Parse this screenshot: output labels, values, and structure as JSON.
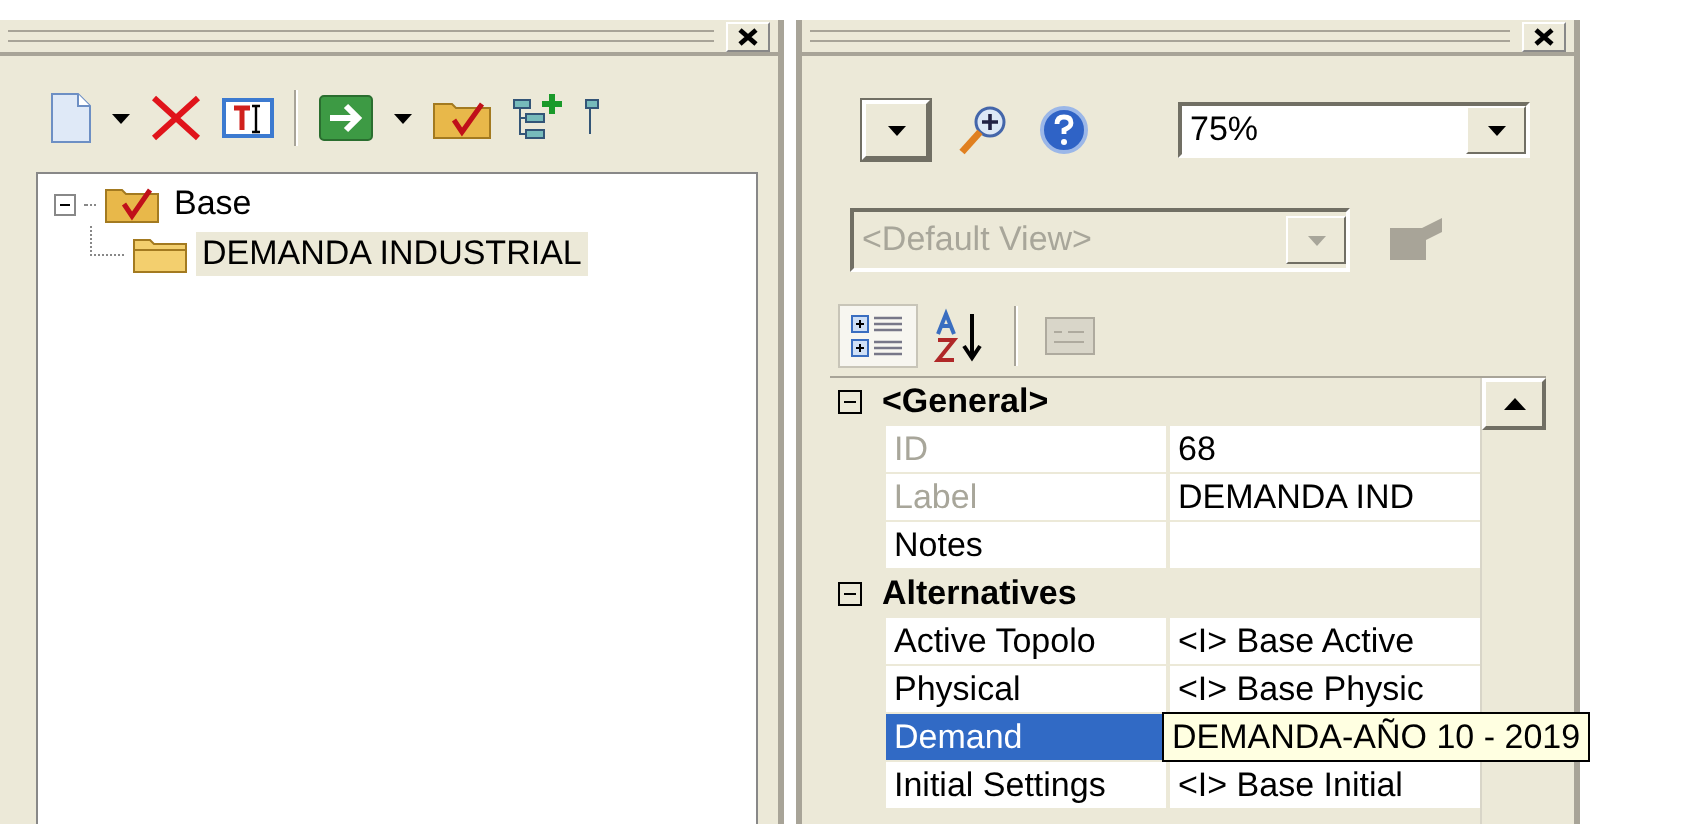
{
  "left_panel": {
    "toolbar": [
      {
        "kind": "new"
      },
      {
        "kind": "caret"
      },
      {
        "kind": "delete"
      },
      {
        "kind": "rename"
      },
      {
        "kind": "separator"
      },
      {
        "kind": "go"
      },
      {
        "kind": "caret"
      },
      {
        "kind": "folder"
      },
      {
        "kind": "tree-add"
      },
      {
        "kind": "tree"
      }
    ],
    "tree": [
      {
        "label": "Base",
        "kind": "checked-folder",
        "expanded": true,
        "selected": false,
        "children": [
          {
            "label": "DEMANDA INDUSTRIAL",
            "kind": "folder",
            "selected": true
          }
        ]
      }
    ]
  },
  "right_panel": {
    "zoom": {
      "value": "75%"
    },
    "view_combo": {
      "value": "<Default View>",
      "disabled": true
    },
    "sort_buttons": [
      {
        "kind": "categorized",
        "selected": true,
        "disabled": false
      },
      {
        "kind": "alphabetical",
        "selected": false,
        "disabled": false
      },
      {
        "kind": "pages",
        "selected": false,
        "disabled": true
      }
    ],
    "property_grid": [
      {
        "title": "<General>",
        "expanded": true,
        "rows": [
          {
            "name": "ID",
            "value": "68",
            "readonly": true,
            "selected": false
          },
          {
            "name": "Label",
            "value": "DEMANDA IND",
            "readonly": true,
            "selected": false
          },
          {
            "name": "Notes",
            "readonly": false,
            "selected": false
          }
        ]
      },
      {
        "title": "Alternatives",
        "expanded": true,
        "rows": [
          {
            "name": "Active Topolo",
            "value": "<I> Base Active",
            "readonly": false,
            "selected": false
          },
          {
            "name": "Physical",
            "value": "<I> Base Physic",
            "readonly": false,
            "selected": false
          },
          {
            "name": "Demand",
            "readonly": false,
            "selected": true
          },
          {
            "name": "Initial Settings",
            "value": "<I> Base Initial",
            "readonly": false,
            "selected": false
          }
        ]
      }
    ],
    "tooltip": "DEMANDA-AÑO 10 - 2019"
  }
}
